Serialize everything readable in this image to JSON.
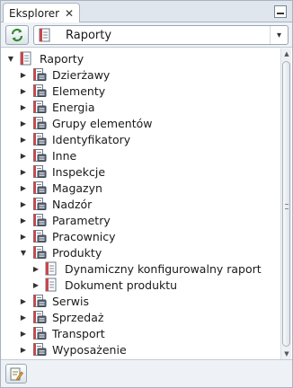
{
  "tab": {
    "title": "Eksplorer",
    "close_glyph": "✕"
  },
  "toolbar": {
    "refresh_icon": "refresh-icon",
    "combo": {
      "selected": "Raporty",
      "icon": "report-icon",
      "arrow": "▾"
    }
  },
  "tree": {
    "root": {
      "label": "Raporty",
      "expanded": true
    },
    "items": [
      {
        "label": "Dzierżawy",
        "expanded": false,
        "level": 1
      },
      {
        "label": "Elementy",
        "expanded": false,
        "level": 1
      },
      {
        "label": "Energia",
        "expanded": false,
        "level": 1
      },
      {
        "label": "Grupy elementów",
        "expanded": false,
        "level": 1
      },
      {
        "label": "Identyfikatory",
        "expanded": false,
        "level": 1
      },
      {
        "label": "Inne",
        "expanded": false,
        "level": 1
      },
      {
        "label": "Inspekcje",
        "expanded": false,
        "level": 1
      },
      {
        "label": "Magazyn",
        "expanded": false,
        "level": 1
      },
      {
        "label": "Nadzór",
        "expanded": false,
        "level": 1
      },
      {
        "label": "Parametry",
        "expanded": false,
        "level": 1
      },
      {
        "label": "Pracownicy",
        "expanded": false,
        "level": 1
      },
      {
        "label": "Produkty",
        "expanded": true,
        "level": 1
      },
      {
        "label": "Dynamiczny konfigurowalny raport",
        "expanded": false,
        "level": 2
      },
      {
        "label": "Dokument produktu",
        "expanded": false,
        "level": 2
      },
      {
        "label": "Serwis",
        "expanded": false,
        "level": 1
      },
      {
        "label": "Sprzedaż",
        "expanded": false,
        "level": 1
      },
      {
        "label": "Transport",
        "expanded": false,
        "level": 1
      },
      {
        "label": "Wyposażenie",
        "expanded": false,
        "level": 1
      }
    ]
  },
  "scrollbar": {
    "up_glyph": "▲",
    "down_glyph": "▼"
  },
  "bottombar": {
    "edit_icon": "edit-report-icon"
  },
  "colors": {
    "accent": "#3a6ea5",
    "border": "#a9b3bf",
    "background": "#f4f6f8"
  }
}
